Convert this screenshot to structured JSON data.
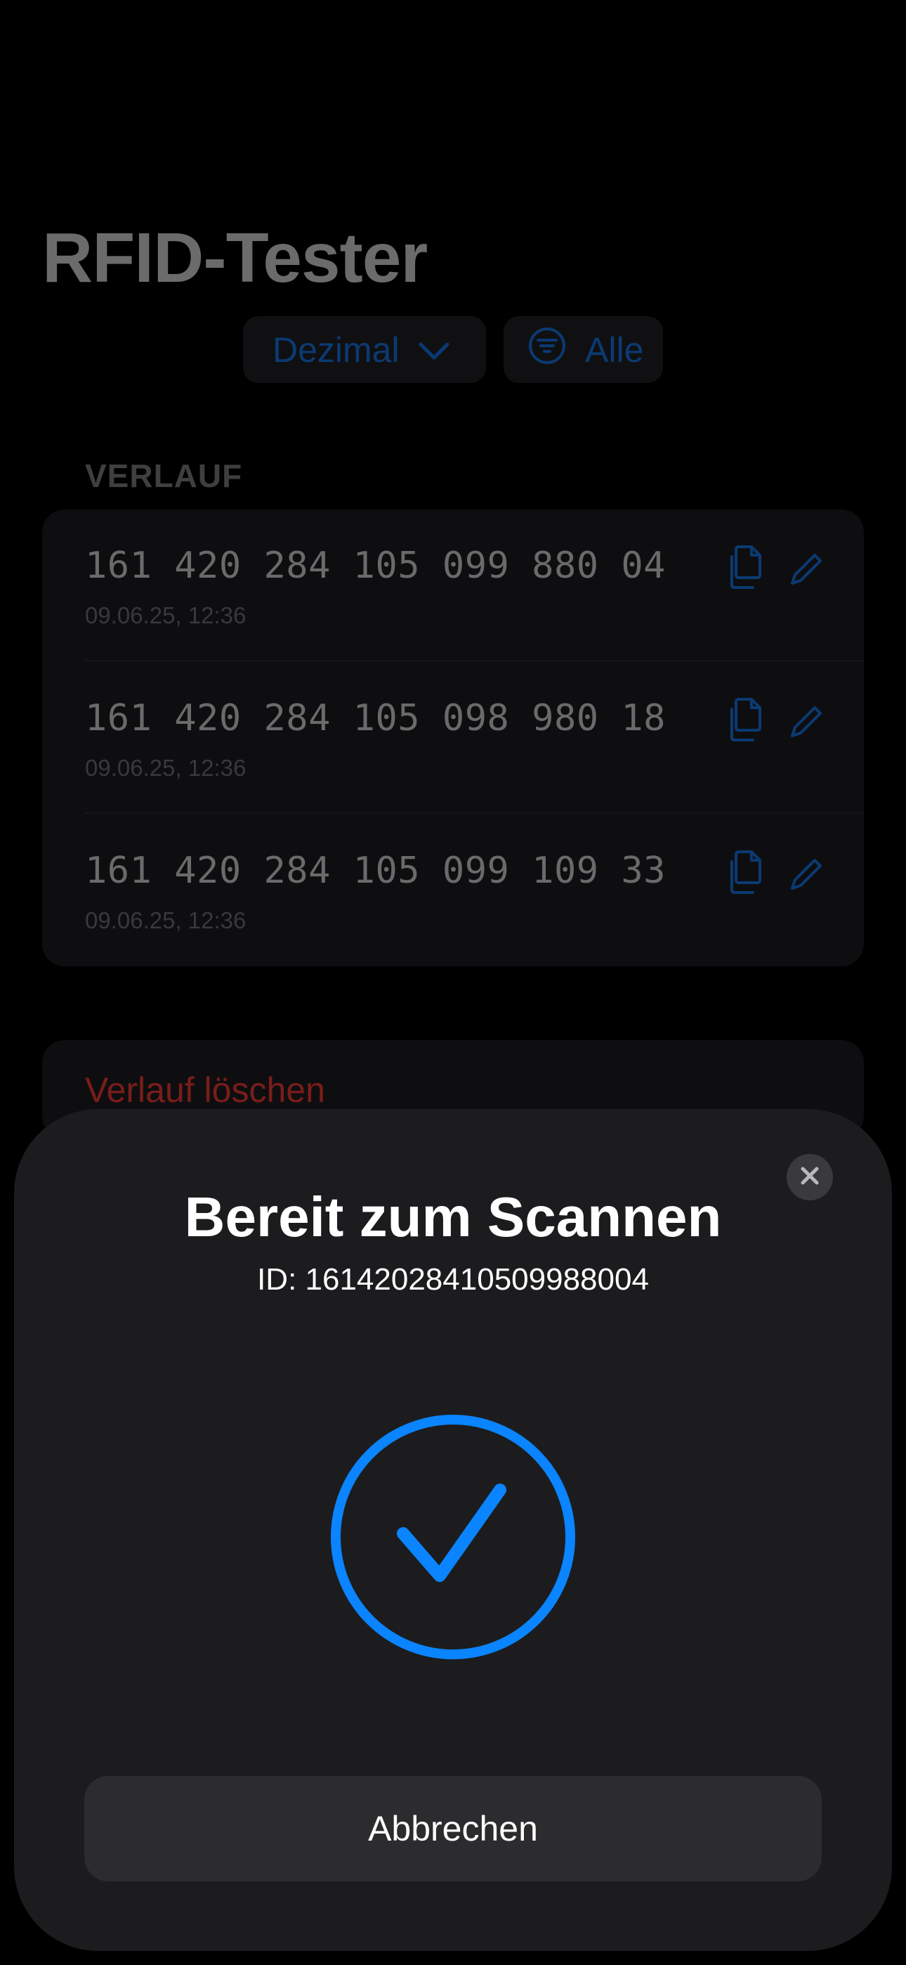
{
  "app": {
    "title": "RFID-Tester",
    "format_picker": {
      "label": "Dezimal",
      "icon": "chevron-down-icon"
    },
    "filter_picker": {
      "label": "Alle",
      "icon": "filter-circle-icon"
    },
    "history": {
      "section_label": "VERLAUF",
      "rows": [
        {
          "uid": "161 420 284 105 099 880 04",
          "timestamp": "09.06.25, 12:36"
        },
        {
          "uid": "161 420 284 105 098 980 18",
          "timestamp": "09.06.25, 12:36"
        },
        {
          "uid": "161 420 284 105 099 109 33",
          "timestamp": "09.06.25, 12:36"
        }
      ],
      "row_actions": {
        "copy_icon": "copy-icon",
        "edit_icon": "pencil-icon"
      }
    },
    "clear_history_label": "Verlauf löschen"
  },
  "scan_sheet": {
    "title": "Bereit zum Scannen",
    "id_text": "ID: 16142028410509988004",
    "status_icon": "checkmark-circle-icon",
    "close_icon": "close-icon",
    "cancel_label": "Abbrechen"
  },
  "colors": {
    "accent": "#0a84ff",
    "destructive": "#7a1d1a",
    "sheet_background": "#1c1c1e"
  }
}
